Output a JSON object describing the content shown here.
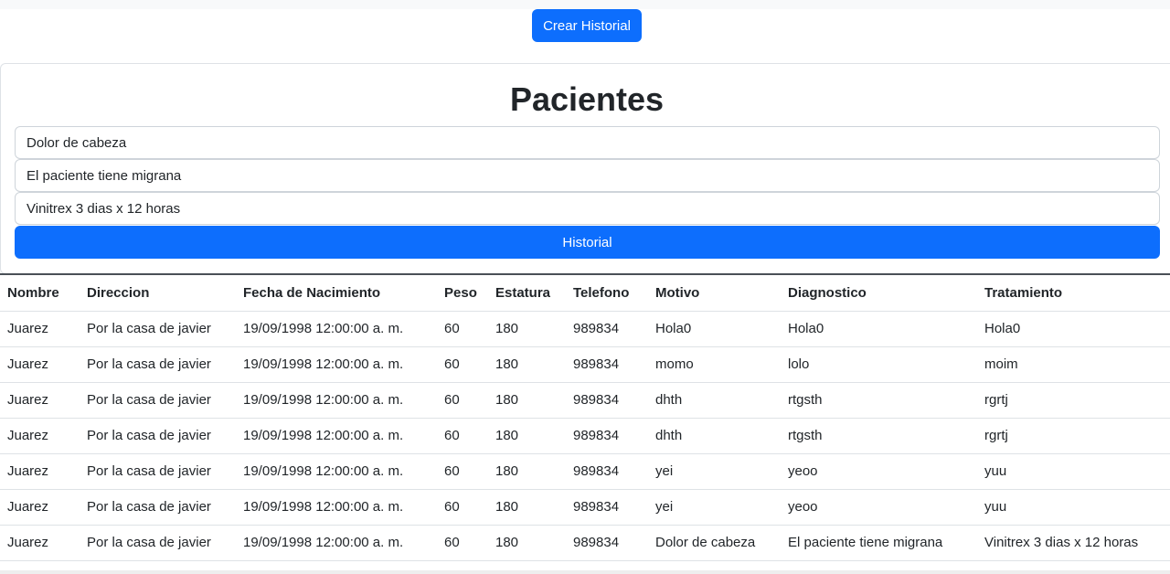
{
  "header": {
    "create_button_label": "Crear Historial"
  },
  "form": {
    "title": "Pacientes",
    "motivo_value": "Dolor de cabeza",
    "diagnostico_value": "El paciente tiene migrana",
    "tratamiento_value": "Vinitrex 3 dias x 12 horas",
    "submit_label": "Historial"
  },
  "table": {
    "headers": [
      "Nombre",
      "Direccion",
      "Fecha de Nacimiento",
      "Peso",
      "Estatura",
      "Telefono",
      "Motivo",
      "Diagnostico",
      "Tratamiento"
    ],
    "rows": [
      [
        "Juarez",
        "Por la casa de javier",
        "19/09/1998 12:00:00 a. m.",
        "60",
        "180",
        "989834",
        "Hola0",
        "Hola0",
        "Hola0"
      ],
      [
        "Juarez",
        "Por la casa de javier",
        "19/09/1998 12:00:00 a. m.",
        "60",
        "180",
        "989834",
        "momo",
        "lolo",
        "moim"
      ],
      [
        "Juarez",
        "Por la casa de javier",
        "19/09/1998 12:00:00 a. m.",
        "60",
        "180",
        "989834",
        "dhth",
        "rtgsth",
        "rgrtj"
      ],
      [
        "Juarez",
        "Por la casa de javier",
        "19/09/1998 12:00:00 a. m.",
        "60",
        "180",
        "989834",
        "dhth",
        "rtgsth",
        "rgrtj"
      ],
      [
        "Juarez",
        "Por la casa de javier",
        "19/09/1998 12:00:00 a. m.",
        "60",
        "180",
        "989834",
        "yei",
        "yeoo",
        "yuu"
      ],
      [
        "Juarez",
        "Por la casa de javier",
        "19/09/1998 12:00:00 a. m.",
        "60",
        "180",
        "989834",
        "yei",
        "yeoo",
        "yuu"
      ],
      [
        "Juarez",
        "Por la casa de javier",
        "19/09/1998 12:00:00 a. m.",
        "60",
        "180",
        "989834",
        "Dolor de cabeza",
        "El paciente tiene migrana",
        "Vinitrex 3 dias x 12 horas"
      ]
    ]
  },
  "colors": {
    "primary": "#0d6efd",
    "border": "#dee2e6",
    "text": "#212529"
  }
}
